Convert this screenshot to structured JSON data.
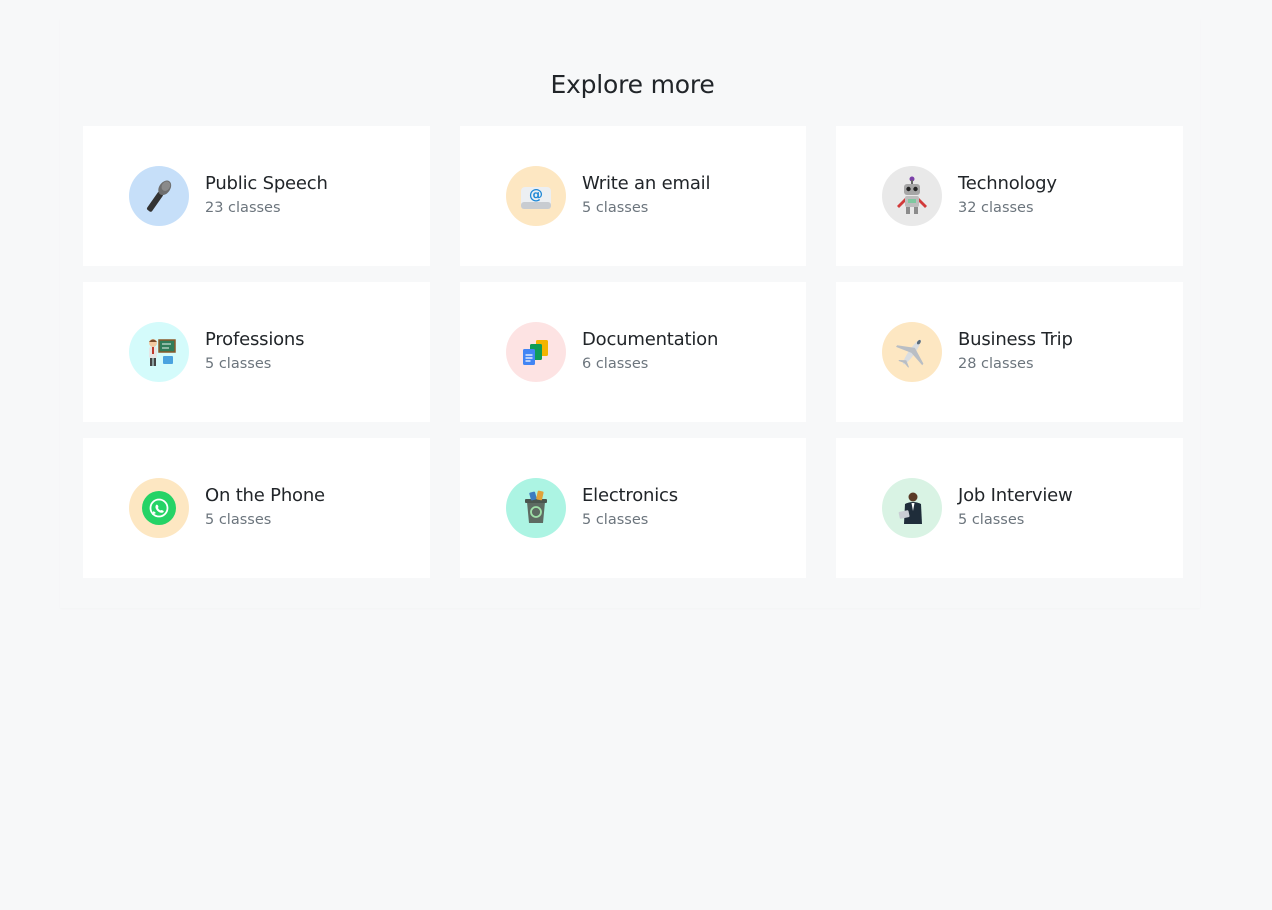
{
  "section": {
    "title": "Explore more"
  },
  "categories": [
    {
      "title": "Public Speech",
      "count": "23 classes",
      "icon": "microphone-icon",
      "bg": "#c6dff9"
    },
    {
      "title": "Write an email",
      "count": "5 classes",
      "icon": "email-icon",
      "bg": "#fde7c2"
    },
    {
      "title": "Technology",
      "count": "32 classes",
      "icon": "robot-icon",
      "bg": "#e9e9e9"
    },
    {
      "title": "Professions",
      "count": "5 classes",
      "icon": "teacher-icon",
      "bg": "#d4fbfb"
    },
    {
      "title": "Documentation",
      "count": "6 classes",
      "icon": "documents-icon",
      "bg": "#fde3e3"
    },
    {
      "title": "Business Trip",
      "count": "28 classes",
      "icon": "airplane-icon",
      "bg": "#fde7c2"
    },
    {
      "title": "On the Phone",
      "count": "5 classes",
      "icon": "whatsapp-icon",
      "bg": "#fde7c2"
    },
    {
      "title": "Electronics",
      "count": "5 classes",
      "icon": "recycle-bin-icon",
      "bg": "#acf4e3"
    },
    {
      "title": "Job Interview",
      "count": "5 classes",
      "icon": "businessman-icon",
      "bg": "#d9f3e4"
    }
  ]
}
